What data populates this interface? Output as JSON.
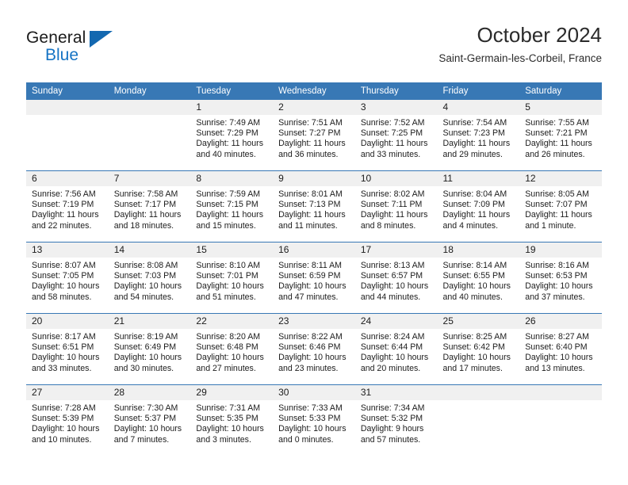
{
  "brand": {
    "name_part1": "General",
    "name_part2": "Blue",
    "triangle_icon": "triangle-icon",
    "accent_color": "#1573c4"
  },
  "header": {
    "title": "October 2024",
    "subtitle": "Saint-Germain-les-Corbeil, France"
  },
  "theme": {
    "header_bg": "#3878b5",
    "daynum_bg": "#f0f0f0",
    "text": "#1c1c1c",
    "separator": "#2f6da8"
  },
  "weekday_headers": [
    "Sunday",
    "Monday",
    "Tuesday",
    "Wednesday",
    "Thursday",
    "Friday",
    "Saturday"
  ],
  "weeks": [
    [
      {
        "day": "",
        "lines": []
      },
      {
        "day": "",
        "lines": []
      },
      {
        "day": "1",
        "lines": [
          "Sunrise: 7:49 AM",
          "Sunset: 7:29 PM",
          "Daylight: 11 hours",
          "and 40 minutes."
        ]
      },
      {
        "day": "2",
        "lines": [
          "Sunrise: 7:51 AM",
          "Sunset: 7:27 PM",
          "Daylight: 11 hours",
          "and 36 minutes."
        ]
      },
      {
        "day": "3",
        "lines": [
          "Sunrise: 7:52 AM",
          "Sunset: 7:25 PM",
          "Daylight: 11 hours",
          "and 33 minutes."
        ]
      },
      {
        "day": "4",
        "lines": [
          "Sunrise: 7:54 AM",
          "Sunset: 7:23 PM",
          "Daylight: 11 hours",
          "and 29 minutes."
        ]
      },
      {
        "day": "5",
        "lines": [
          "Sunrise: 7:55 AM",
          "Sunset: 7:21 PM",
          "Daylight: 11 hours",
          "and 26 minutes."
        ]
      }
    ],
    [
      {
        "day": "6",
        "lines": [
          "Sunrise: 7:56 AM",
          "Sunset: 7:19 PM",
          "Daylight: 11 hours",
          "and 22 minutes."
        ]
      },
      {
        "day": "7",
        "lines": [
          "Sunrise: 7:58 AM",
          "Sunset: 7:17 PM",
          "Daylight: 11 hours",
          "and 18 minutes."
        ]
      },
      {
        "day": "8",
        "lines": [
          "Sunrise: 7:59 AM",
          "Sunset: 7:15 PM",
          "Daylight: 11 hours",
          "and 15 minutes."
        ]
      },
      {
        "day": "9",
        "lines": [
          "Sunrise: 8:01 AM",
          "Sunset: 7:13 PM",
          "Daylight: 11 hours",
          "and 11 minutes."
        ]
      },
      {
        "day": "10",
        "lines": [
          "Sunrise: 8:02 AM",
          "Sunset: 7:11 PM",
          "Daylight: 11 hours",
          "and 8 minutes."
        ]
      },
      {
        "day": "11",
        "lines": [
          "Sunrise: 8:04 AM",
          "Sunset: 7:09 PM",
          "Daylight: 11 hours",
          "and 4 minutes."
        ]
      },
      {
        "day": "12",
        "lines": [
          "Sunrise: 8:05 AM",
          "Sunset: 7:07 PM",
          "Daylight: 11 hours",
          "and 1 minute."
        ]
      }
    ],
    [
      {
        "day": "13",
        "lines": [
          "Sunrise: 8:07 AM",
          "Sunset: 7:05 PM",
          "Daylight: 10 hours",
          "and 58 minutes."
        ]
      },
      {
        "day": "14",
        "lines": [
          "Sunrise: 8:08 AM",
          "Sunset: 7:03 PM",
          "Daylight: 10 hours",
          "and 54 minutes."
        ]
      },
      {
        "day": "15",
        "lines": [
          "Sunrise: 8:10 AM",
          "Sunset: 7:01 PM",
          "Daylight: 10 hours",
          "and 51 minutes."
        ]
      },
      {
        "day": "16",
        "lines": [
          "Sunrise: 8:11 AM",
          "Sunset: 6:59 PM",
          "Daylight: 10 hours",
          "and 47 minutes."
        ]
      },
      {
        "day": "17",
        "lines": [
          "Sunrise: 8:13 AM",
          "Sunset: 6:57 PM",
          "Daylight: 10 hours",
          "and 44 minutes."
        ]
      },
      {
        "day": "18",
        "lines": [
          "Sunrise: 8:14 AM",
          "Sunset: 6:55 PM",
          "Daylight: 10 hours",
          "and 40 minutes."
        ]
      },
      {
        "day": "19",
        "lines": [
          "Sunrise: 8:16 AM",
          "Sunset: 6:53 PM",
          "Daylight: 10 hours",
          "and 37 minutes."
        ]
      }
    ],
    [
      {
        "day": "20",
        "lines": [
          "Sunrise: 8:17 AM",
          "Sunset: 6:51 PM",
          "Daylight: 10 hours",
          "and 33 minutes."
        ]
      },
      {
        "day": "21",
        "lines": [
          "Sunrise: 8:19 AM",
          "Sunset: 6:49 PM",
          "Daylight: 10 hours",
          "and 30 minutes."
        ]
      },
      {
        "day": "22",
        "lines": [
          "Sunrise: 8:20 AM",
          "Sunset: 6:48 PM",
          "Daylight: 10 hours",
          "and 27 minutes."
        ]
      },
      {
        "day": "23",
        "lines": [
          "Sunrise: 8:22 AM",
          "Sunset: 6:46 PM",
          "Daylight: 10 hours",
          "and 23 minutes."
        ]
      },
      {
        "day": "24",
        "lines": [
          "Sunrise: 8:24 AM",
          "Sunset: 6:44 PM",
          "Daylight: 10 hours",
          "and 20 minutes."
        ]
      },
      {
        "day": "25",
        "lines": [
          "Sunrise: 8:25 AM",
          "Sunset: 6:42 PM",
          "Daylight: 10 hours",
          "and 17 minutes."
        ]
      },
      {
        "day": "26",
        "lines": [
          "Sunrise: 8:27 AM",
          "Sunset: 6:40 PM",
          "Daylight: 10 hours",
          "and 13 minutes."
        ]
      }
    ],
    [
      {
        "day": "27",
        "lines": [
          "Sunrise: 7:28 AM",
          "Sunset: 5:39 PM",
          "Daylight: 10 hours",
          "and 10 minutes."
        ]
      },
      {
        "day": "28",
        "lines": [
          "Sunrise: 7:30 AM",
          "Sunset: 5:37 PM",
          "Daylight: 10 hours",
          "and 7 minutes."
        ]
      },
      {
        "day": "29",
        "lines": [
          "Sunrise: 7:31 AM",
          "Sunset: 5:35 PM",
          "Daylight: 10 hours",
          "and 3 minutes."
        ]
      },
      {
        "day": "30",
        "lines": [
          "Sunrise: 7:33 AM",
          "Sunset: 5:33 PM",
          "Daylight: 10 hours",
          "and 0 minutes."
        ]
      },
      {
        "day": "31",
        "lines": [
          "Sunrise: 7:34 AM",
          "Sunset: 5:32 PM",
          "Daylight: 9 hours",
          "and 57 minutes."
        ]
      },
      {
        "day": "",
        "lines": []
      },
      {
        "day": "",
        "lines": []
      }
    ]
  ]
}
